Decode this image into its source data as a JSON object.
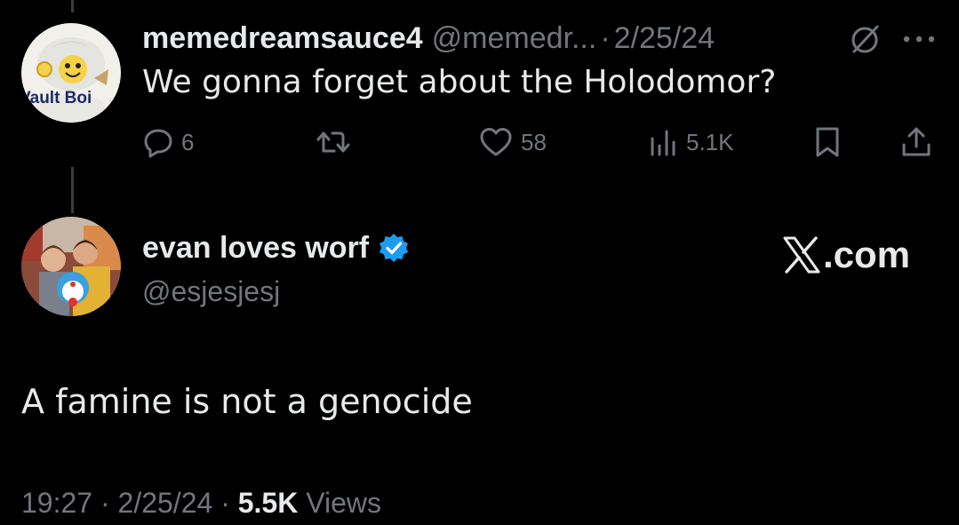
{
  "reply": {
    "display_name": "memedreamsauce4",
    "handle": "@memedr...",
    "separator": "·",
    "date": "2/25/24",
    "text": "We gonna forget about the Holodomor?",
    "avatar_text": "Vault Boi",
    "actions": {
      "reply_count": "6",
      "retweet_count": "",
      "like_count": "58",
      "views_count": "5.1K"
    },
    "icons": [
      "grok-icon",
      "more-icon",
      "reply-icon",
      "retweet-icon",
      "like-icon",
      "views-icon",
      "bookmark-icon",
      "share-icon"
    ]
  },
  "tweet": {
    "display_name": "evan loves worf",
    "handle": "@esjesjesj",
    "verified": true,
    "text": "A famine is not a genocide",
    "meta": {
      "time": "19:27",
      "separator": "·",
      "date": "2/25/24",
      "separator2": "·",
      "views_count": "5.5K",
      "views_label": "Views"
    }
  },
  "watermark": {
    "text": ".com"
  },
  "colors": {
    "background": "#000000",
    "primary_text": "#e7e9ea",
    "secondary_text": "#71767b",
    "verified_blue": "#1d9bf0",
    "thread_line": "#3a3d40"
  }
}
